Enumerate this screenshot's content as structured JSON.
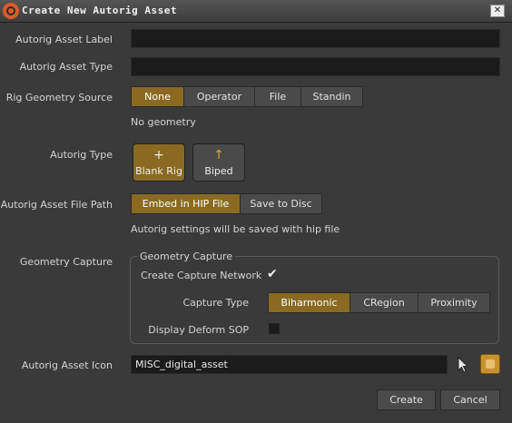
{
  "window": {
    "title": "Create New Autorig Asset",
    "close_label": "✕"
  },
  "fields": {
    "asset_label": {
      "label": "Autorig Asset Label",
      "value": ""
    },
    "asset_type": {
      "label": "Autorig Asset Type",
      "value": ""
    }
  },
  "rig_geometry_source": {
    "label": "Rig Geometry Source",
    "options": [
      "None",
      "Operator",
      "File",
      "Standin"
    ],
    "selected": "None",
    "status": "No geometry"
  },
  "autorig_type": {
    "label": "Autorig Type",
    "options": [
      {
        "label": "Blank Rig",
        "icon": "plus-icon",
        "glyph": "+"
      },
      {
        "label": "Biped",
        "icon": "arrow-up-icon",
        "glyph": "↑"
      }
    ],
    "selected": "Blank Rig"
  },
  "file_path": {
    "label": "Autorig Asset File Path",
    "options": [
      "Embed in HIP File",
      "Save to Disc"
    ],
    "selected": "Embed in HIP File",
    "note": "Autorig settings will be saved with hip file"
  },
  "geometry_capture": {
    "label": "Geometry Capture",
    "group_title": "Geometry Capture",
    "create_network": {
      "label": "Create Capture Network",
      "checked": true,
      "mark": "✔"
    },
    "capture_type": {
      "label": "Capture Type",
      "options": [
        "Biharmonic",
        "CRegion",
        "Proximity"
      ],
      "selected": "Biharmonic"
    },
    "display_deform": {
      "label": "Display Deform SOP",
      "checked": false
    }
  },
  "asset_icon": {
    "label": "Autorig Asset Icon",
    "value": "MISC_digital_asset",
    "icons": [
      "cursor-arrow-icon",
      "folder-browse-icon"
    ]
  },
  "footer": {
    "create_label": "Create",
    "cancel_label": "Cancel"
  },
  "colors": {
    "accent": "#8a6a22",
    "background": "#3a3a3a",
    "field": "#1b1b1b"
  }
}
